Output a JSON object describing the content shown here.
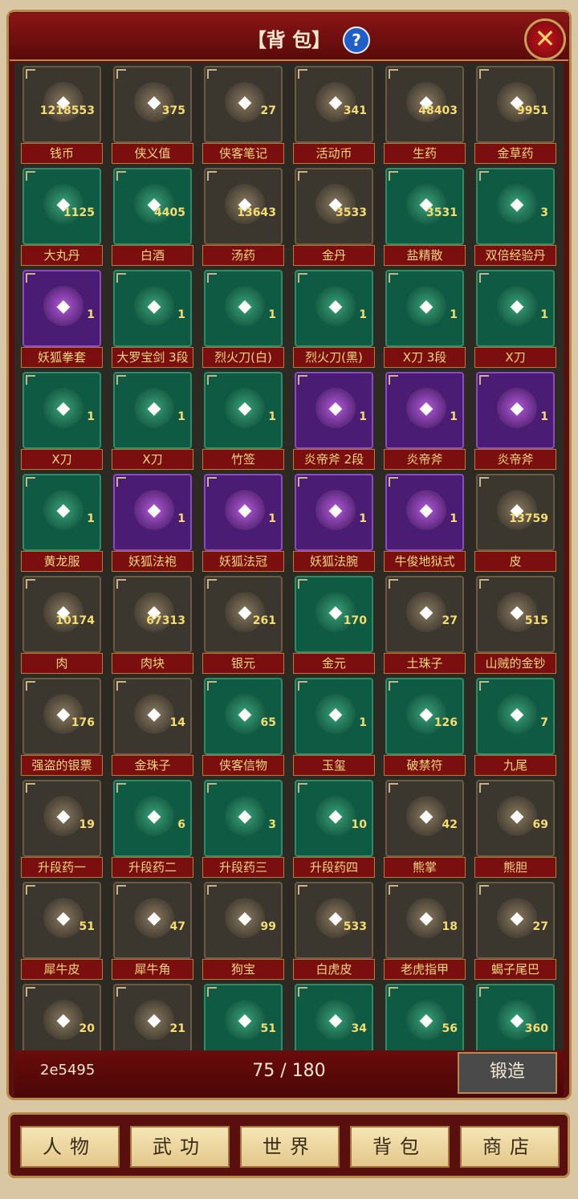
{
  "header": {
    "title": "【背 包】",
    "help_icon": "question-icon",
    "close_icon": "close-icon"
  },
  "items": [
    {
      "name": "钱币",
      "qty": "1218553",
      "style": "dark"
    },
    {
      "name": "侠义值",
      "qty": "375",
      "style": "dark"
    },
    {
      "name": "侠客笔记",
      "qty": "27",
      "style": "dark"
    },
    {
      "name": "活动币",
      "qty": "341",
      "style": "dark"
    },
    {
      "name": "生药",
      "qty": "48403",
      "style": "dark"
    },
    {
      "name": "金草药",
      "qty": "9951",
      "style": "dark"
    },
    {
      "name": "大丸丹",
      "qty": "1125",
      "style": "green"
    },
    {
      "name": "白酒",
      "qty": "4405",
      "style": "green"
    },
    {
      "name": "汤药",
      "qty": "13643",
      "style": "dark"
    },
    {
      "name": "金丹",
      "qty": "3533",
      "style": "dark"
    },
    {
      "name": "盐精散",
      "qty": "3531",
      "style": "green"
    },
    {
      "name": "双倍经验丹",
      "qty": "3",
      "style": "green"
    },
    {
      "name": "妖狐拳套",
      "qty": "1",
      "style": "purple"
    },
    {
      "name": "大罗宝剑 3段",
      "qty": "1",
      "style": "green"
    },
    {
      "name": "烈火刀(白)",
      "qty": "1",
      "style": "green"
    },
    {
      "name": "烈火刀(黑)",
      "qty": "1",
      "style": "green"
    },
    {
      "name": "X刀 3段",
      "qty": "1",
      "style": "green"
    },
    {
      "name": "X刀",
      "qty": "1",
      "style": "green"
    },
    {
      "name": "X刀",
      "qty": "1",
      "style": "green"
    },
    {
      "name": "X刀",
      "qty": "1",
      "style": "green"
    },
    {
      "name": "竹签",
      "qty": "1",
      "style": "green"
    },
    {
      "name": "炎帝斧 2段",
      "qty": "1",
      "style": "purple"
    },
    {
      "name": "炎帝斧",
      "qty": "1",
      "style": "purple"
    },
    {
      "name": "炎帝斧",
      "qty": "1",
      "style": "purple"
    },
    {
      "name": "黄龙服",
      "qty": "1",
      "style": "green"
    },
    {
      "name": "妖狐法袍",
      "qty": "1",
      "style": "purple"
    },
    {
      "name": "妖狐法冠",
      "qty": "1",
      "style": "purple"
    },
    {
      "name": "妖狐法腕",
      "qty": "1",
      "style": "purple"
    },
    {
      "name": "牛俊地狱式",
      "qty": "1",
      "style": "purple"
    },
    {
      "name": "皮",
      "qty": "13759",
      "style": "dark"
    },
    {
      "name": "肉",
      "qty": "10174",
      "style": "dark"
    },
    {
      "name": "肉块",
      "qty": "67313",
      "style": "dark"
    },
    {
      "name": "银元",
      "qty": "261",
      "style": "dark"
    },
    {
      "name": "金元",
      "qty": "170",
      "style": "green"
    },
    {
      "name": "土珠子",
      "qty": "27",
      "style": "dark"
    },
    {
      "name": "山贼的金钞",
      "qty": "515",
      "style": "dark"
    },
    {
      "name": "强盗的银票",
      "qty": "176",
      "style": "dark"
    },
    {
      "name": "金珠子",
      "qty": "14",
      "style": "dark"
    },
    {
      "name": "侠客信物",
      "qty": "65",
      "style": "green"
    },
    {
      "name": "玉玺",
      "qty": "1",
      "style": "green"
    },
    {
      "name": "破禁符",
      "qty": "126",
      "style": "green"
    },
    {
      "name": "九尾",
      "qty": "7",
      "style": "green"
    },
    {
      "name": "升段药一",
      "qty": "19",
      "style": "dark"
    },
    {
      "name": "升段药二",
      "qty": "6",
      "style": "green"
    },
    {
      "name": "升段药三",
      "qty": "3",
      "style": "green"
    },
    {
      "name": "升段药四",
      "qty": "10",
      "style": "green"
    },
    {
      "name": "熊掌",
      "qty": "42",
      "style": "dark"
    },
    {
      "name": "熊胆",
      "qty": "69",
      "style": "dark"
    },
    {
      "name": "犀牛皮",
      "qty": "51",
      "style": "dark"
    },
    {
      "name": "犀牛角",
      "qty": "47",
      "style": "dark"
    },
    {
      "name": "狗宝",
      "qty": "99",
      "style": "dark"
    },
    {
      "name": "白虎皮",
      "qty": "533",
      "style": "dark"
    },
    {
      "name": "老虎指甲",
      "qty": "18",
      "style": "dark"
    },
    {
      "name": "蝎子尾巴",
      "qty": "27",
      "style": "dark"
    },
    {
      "name": "",
      "qty": "20",
      "style": "dark"
    },
    {
      "name": "",
      "qty": "21",
      "style": "dark"
    },
    {
      "name": "",
      "qty": "51",
      "style": "green"
    },
    {
      "name": "",
      "qty": "34",
      "style": "green"
    },
    {
      "name": "",
      "qty": "56",
      "style": "green"
    },
    {
      "name": "",
      "qty": "360",
      "style": "green"
    }
  ],
  "footer": {
    "user": "2e5495",
    "capacity": "75 / 180",
    "forge_label": "锻造"
  },
  "nav": [
    "人物",
    "武功",
    "世界",
    "背包",
    "商店"
  ]
}
